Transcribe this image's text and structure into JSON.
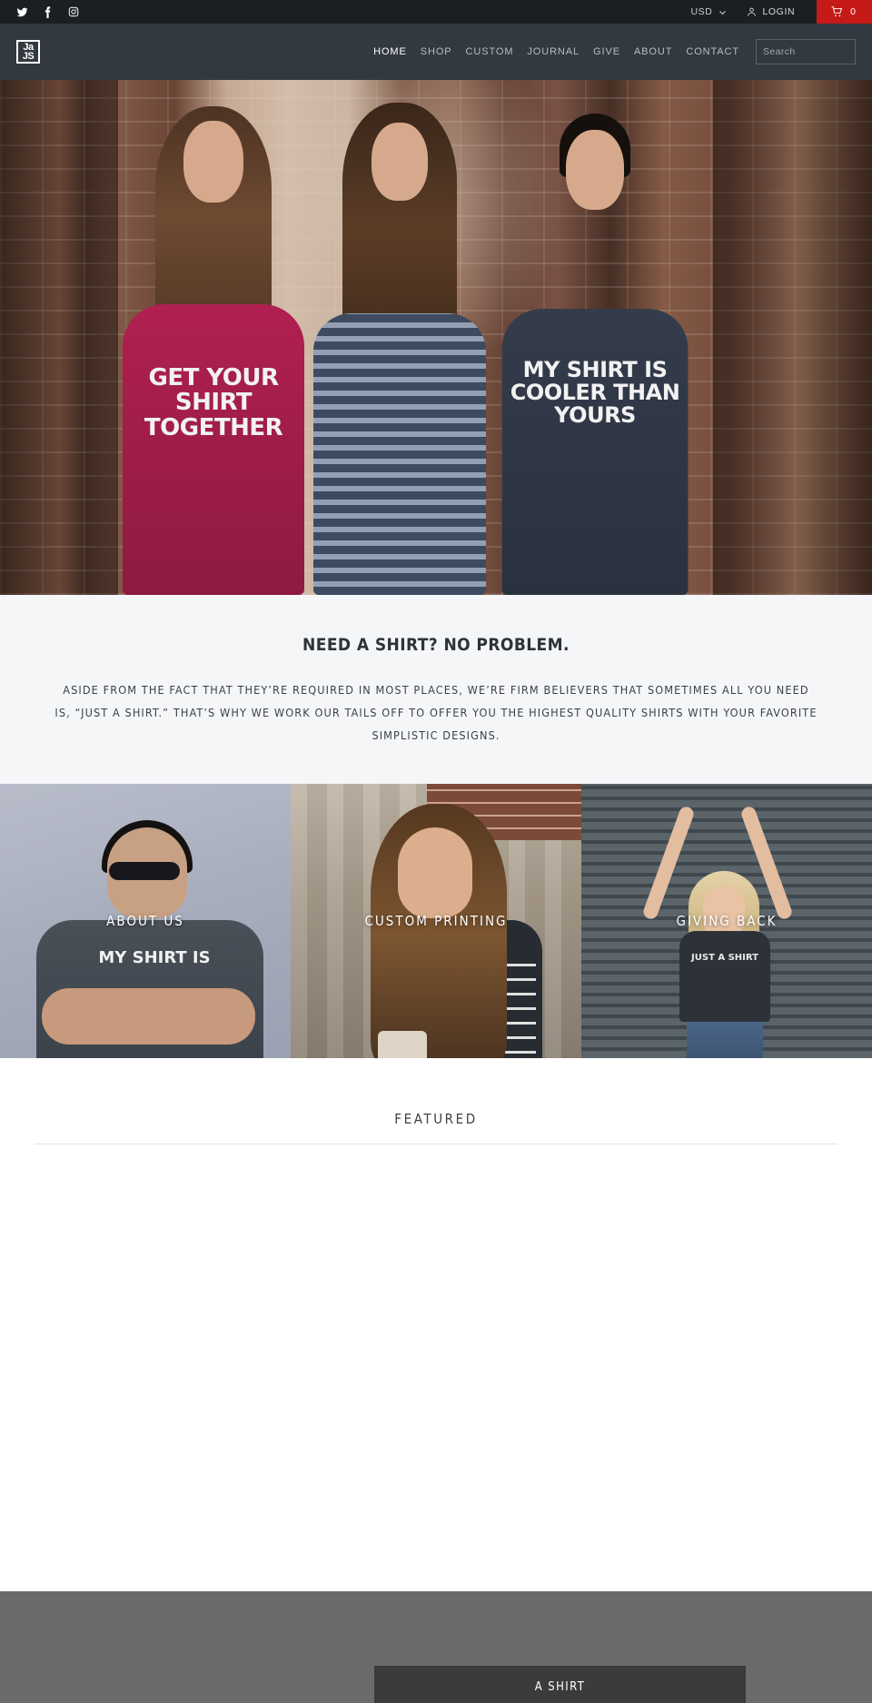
{
  "topbar": {
    "social": [
      {
        "name": "twitter-icon",
        "label": "Twitter"
      },
      {
        "name": "facebook-icon",
        "label": "Facebook"
      },
      {
        "name": "instagram-icon",
        "label": "Instagram"
      }
    ],
    "currency": "USD",
    "login_label": "LOGIN",
    "cart_count": "0",
    "cart_color": "#c51a17"
  },
  "header": {
    "logo_line1": "Ja",
    "logo_line2": "JS",
    "nav": [
      {
        "label": "HOME",
        "active": true
      },
      {
        "label": "SHOP",
        "active": false
      },
      {
        "label": "CUSTOM",
        "active": false
      },
      {
        "label": "JOURNAL",
        "active": false
      },
      {
        "label": "GIVE",
        "active": false
      },
      {
        "label": "ABOUT",
        "active": false
      },
      {
        "label": "CONTACT",
        "active": false
      }
    ],
    "search_placeholder": "Search",
    "search_value": ""
  },
  "hero": {
    "shirt1_text": "GET YOUR SHIRT TOGETHER",
    "shirt3_text": "MY SHIRT IS COOLER THAN YOURS"
  },
  "intro": {
    "heading": "NEED A SHIRT? NO PROBLEM.",
    "body": "ASIDE FROM THE FACT THAT THEY’RE REQUIRED IN MOST PLACES, WE’RE FIRM BELIEVERS THAT SOMETIMES ALL YOU NEED IS, “JUST A SHIRT.” THAT’S WHY WE WORK OUR TAILS OFF TO OFFER YOU THE HIGHEST QUALITY SHIRTS WITH YOUR FAVORITE SIMPLISTIC DESIGNS."
  },
  "tiles": [
    {
      "label": "ABOUT US",
      "shirt_text": "MY SHIRT IS"
    },
    {
      "label": "CUSTOM PRINTING",
      "shirt_text": ""
    },
    {
      "label": "GIVING BACK",
      "shirt_text": "JUST A SHIRT"
    }
  ],
  "featured": {
    "heading": "FEATURED"
  },
  "band": {
    "card_label": "A SHIRT"
  }
}
